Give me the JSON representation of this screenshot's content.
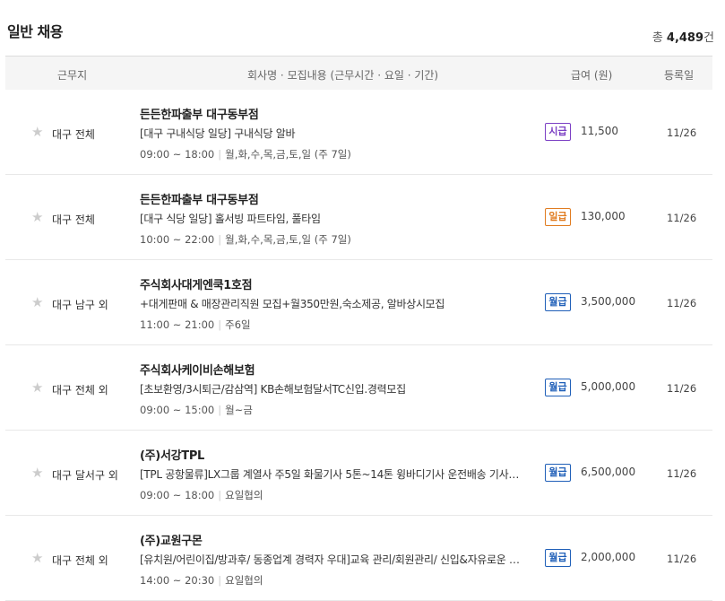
{
  "header": {
    "title": "일반 채용",
    "total_prefix": "총 ",
    "total_count": "4,489",
    "total_suffix": "건"
  },
  "columns": {
    "location": "근무지",
    "company": "회사명 · 모집내용 (근무시간 · 요일 · 기간)",
    "pay": "급여 (원)",
    "date": "등록일"
  },
  "colors": {
    "hourly": "#7b3fc4",
    "daily": "#e07b1f",
    "monthly": "#1f5fb8"
  },
  "rows": [
    {
      "location": "대구 전체",
      "company": "든든한파출부 대구동부점",
      "desc": "[대구 구내식당 일당] 구내식당 알바",
      "time": "09:00 ~ 18:00",
      "days": "월,화,수,목,금,토,일 (주 7일)",
      "pay_type": "시급",
      "pay_kind": "hourly",
      "amount": "11,500",
      "date": "11/26"
    },
    {
      "location": "대구 전체",
      "company": "든든한파출부 대구동부점",
      "desc": "[대구 식당 일당] 홀서빙 파트타임, 풀타임",
      "time": "10:00 ~ 22:00",
      "days": "월,화,수,목,금,토,일 (주 7일)",
      "pay_type": "일급",
      "pay_kind": "daily",
      "amount": "130,000",
      "date": "11/26"
    },
    {
      "location": "대구 남구 외",
      "company": "주식회사대게엔쿡1호점",
      "desc": "+대게판매 & 매장관리직원 모집+월350만원,숙소제공, 알바상시모집",
      "time": "11:00 ~ 21:00",
      "days": "주6일",
      "pay_type": "월급",
      "pay_kind": "monthly",
      "amount": "3,500,000",
      "date": "11/26"
    },
    {
      "location": "대구 전체 외",
      "company": "주식회사케이비손해보험",
      "desc": "[초보환영/3시퇴근/감삼역] KB손해보험달서TC신입.경력모집",
      "time": "09:00 ~ 15:00",
      "days": "월~금",
      "pay_type": "월급",
      "pay_kind": "monthly",
      "amount": "5,000,000",
      "date": "11/26"
    },
    {
      "location": "대구 달서구 외",
      "company": "(주)서강TPL",
      "desc": "[TPL 공항물류]LX그룹 계열사 주5일 화물기사 5톤~14톤 윙바디기사 운전배송 기사 모집",
      "time": "09:00 ~ 18:00",
      "days": "요일협의",
      "pay_type": "월급",
      "pay_kind": "monthly",
      "amount": "6,500,000",
      "date": "11/26"
    },
    {
      "location": "대구 전체 외",
      "company": "(주)교원구몬",
      "desc": "[유치원/어린이집/방과후/ 동종업계 경력자 우대]교육 관리/회원관리/ 신입&자유로운 근무",
      "time": "14:00 ~ 20:30",
      "days": "요일협의",
      "pay_type": "월급",
      "pay_kind": "monthly",
      "amount": "2,000,000",
      "date": "11/26"
    }
  ]
}
